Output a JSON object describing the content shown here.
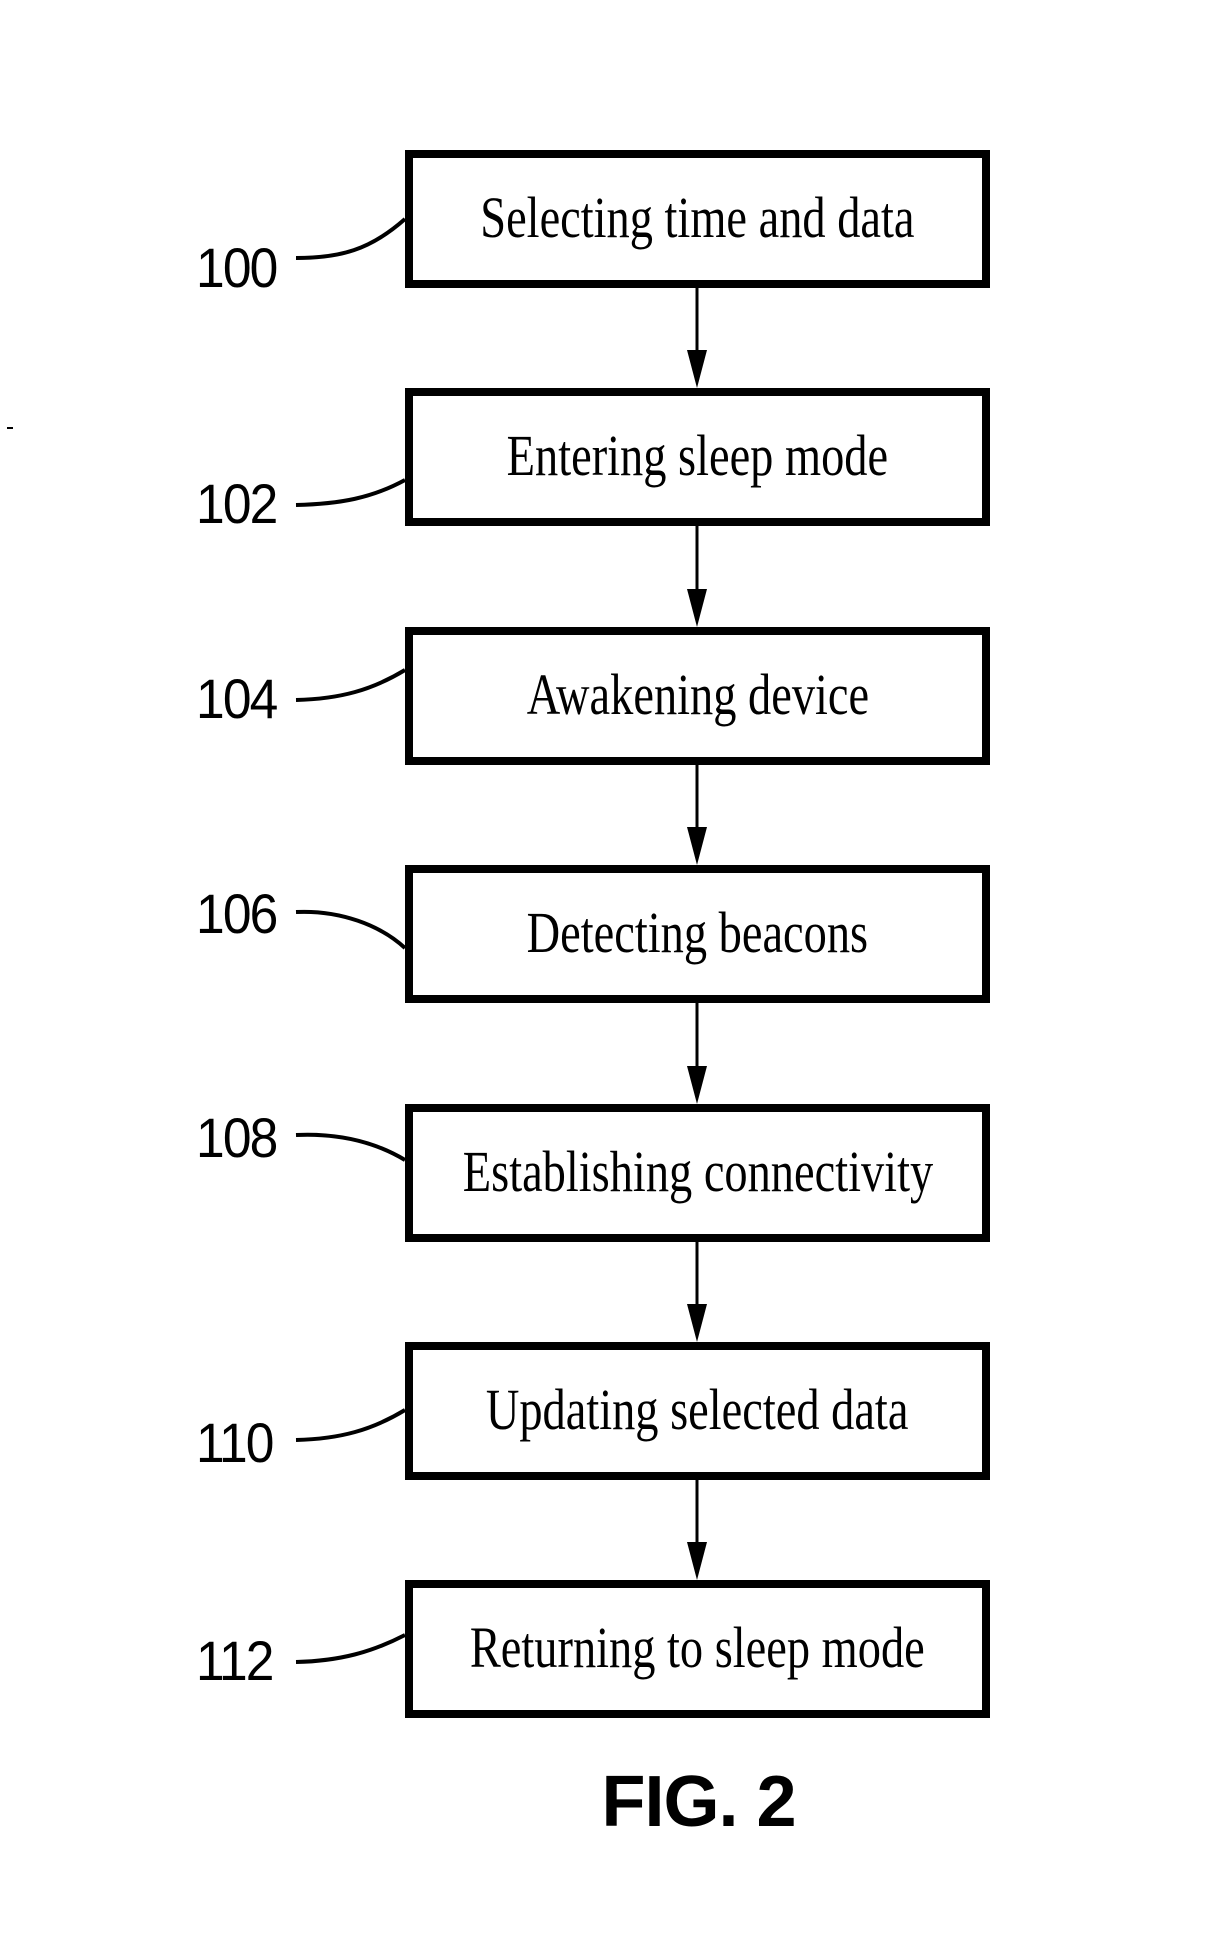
{
  "figure": {
    "caption": "FIG. 2",
    "steps": [
      {
        "ref": "100",
        "label": "Selecting time and data"
      },
      {
        "ref": "102",
        "label": "Entering sleep mode"
      },
      {
        "ref": "104",
        "label": "Awakening device"
      },
      {
        "ref": "106",
        "label": "Detecting beacons"
      },
      {
        "ref": "108",
        "label": "Establishing connectivity"
      },
      {
        "ref": "110",
        "label": "Updating selected data"
      },
      {
        "ref": "112",
        "label": "Returning to sleep mode"
      }
    ],
    "flow": [
      {
        "from": "100",
        "to": "102"
      },
      {
        "from": "102",
        "to": "104"
      },
      {
        "from": "104",
        "to": "106"
      },
      {
        "from": "106",
        "to": "108"
      },
      {
        "from": "108",
        "to": "110"
      },
      {
        "from": "110",
        "to": "112"
      }
    ]
  }
}
